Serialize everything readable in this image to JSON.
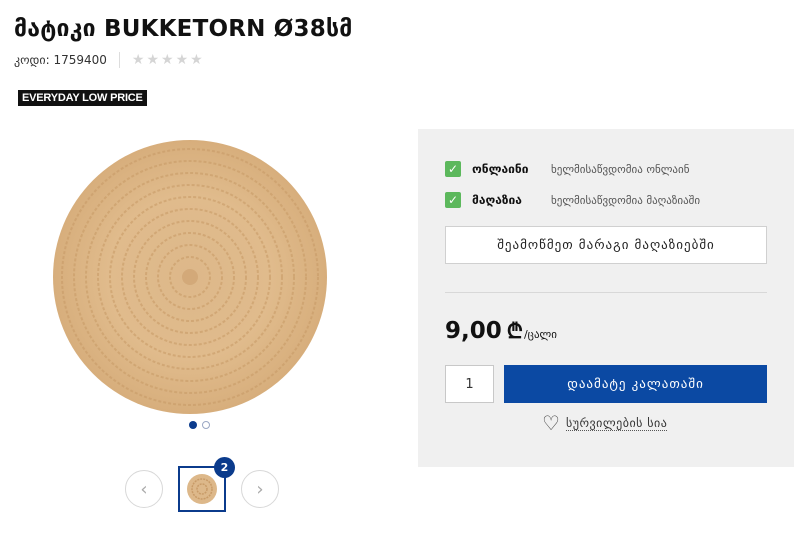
{
  "product": {
    "title": "მატიკი BUKKETORN Ø38სმ",
    "code_label": "კოდი: 1759400",
    "rating_stars": 5,
    "rating_value": 0,
    "badge": "EVERYDAY LOW PRICE"
  },
  "gallery": {
    "image_count": "2",
    "prev_icon": "chevron-left-icon",
    "next_icon": "chevron-right-icon",
    "active_dot": 0
  },
  "availability": [
    {
      "label": "ონლაინი",
      "status": "ხელმისაწვდომია ონლაინ"
    },
    {
      "label": "მაღაზია",
      "status": "ხელმისაწვდომია მაღაზიაში"
    }
  ],
  "actions": {
    "check_stores": "შეამოწმეთ მარაგი მაღაზიებში",
    "add_to_cart": "დაამატე კალათაში",
    "wishlist": "სურვილების სია"
  },
  "price": {
    "amount": "9,00",
    "currency": "₾",
    "unit": "/ცალი"
  },
  "quantity": "1",
  "colors": {
    "brand_blue": "#0b49a3",
    "dark_blue": "#0b3b8c",
    "check_green": "#5cb85c",
    "panel_bg": "#f0f0f0"
  }
}
